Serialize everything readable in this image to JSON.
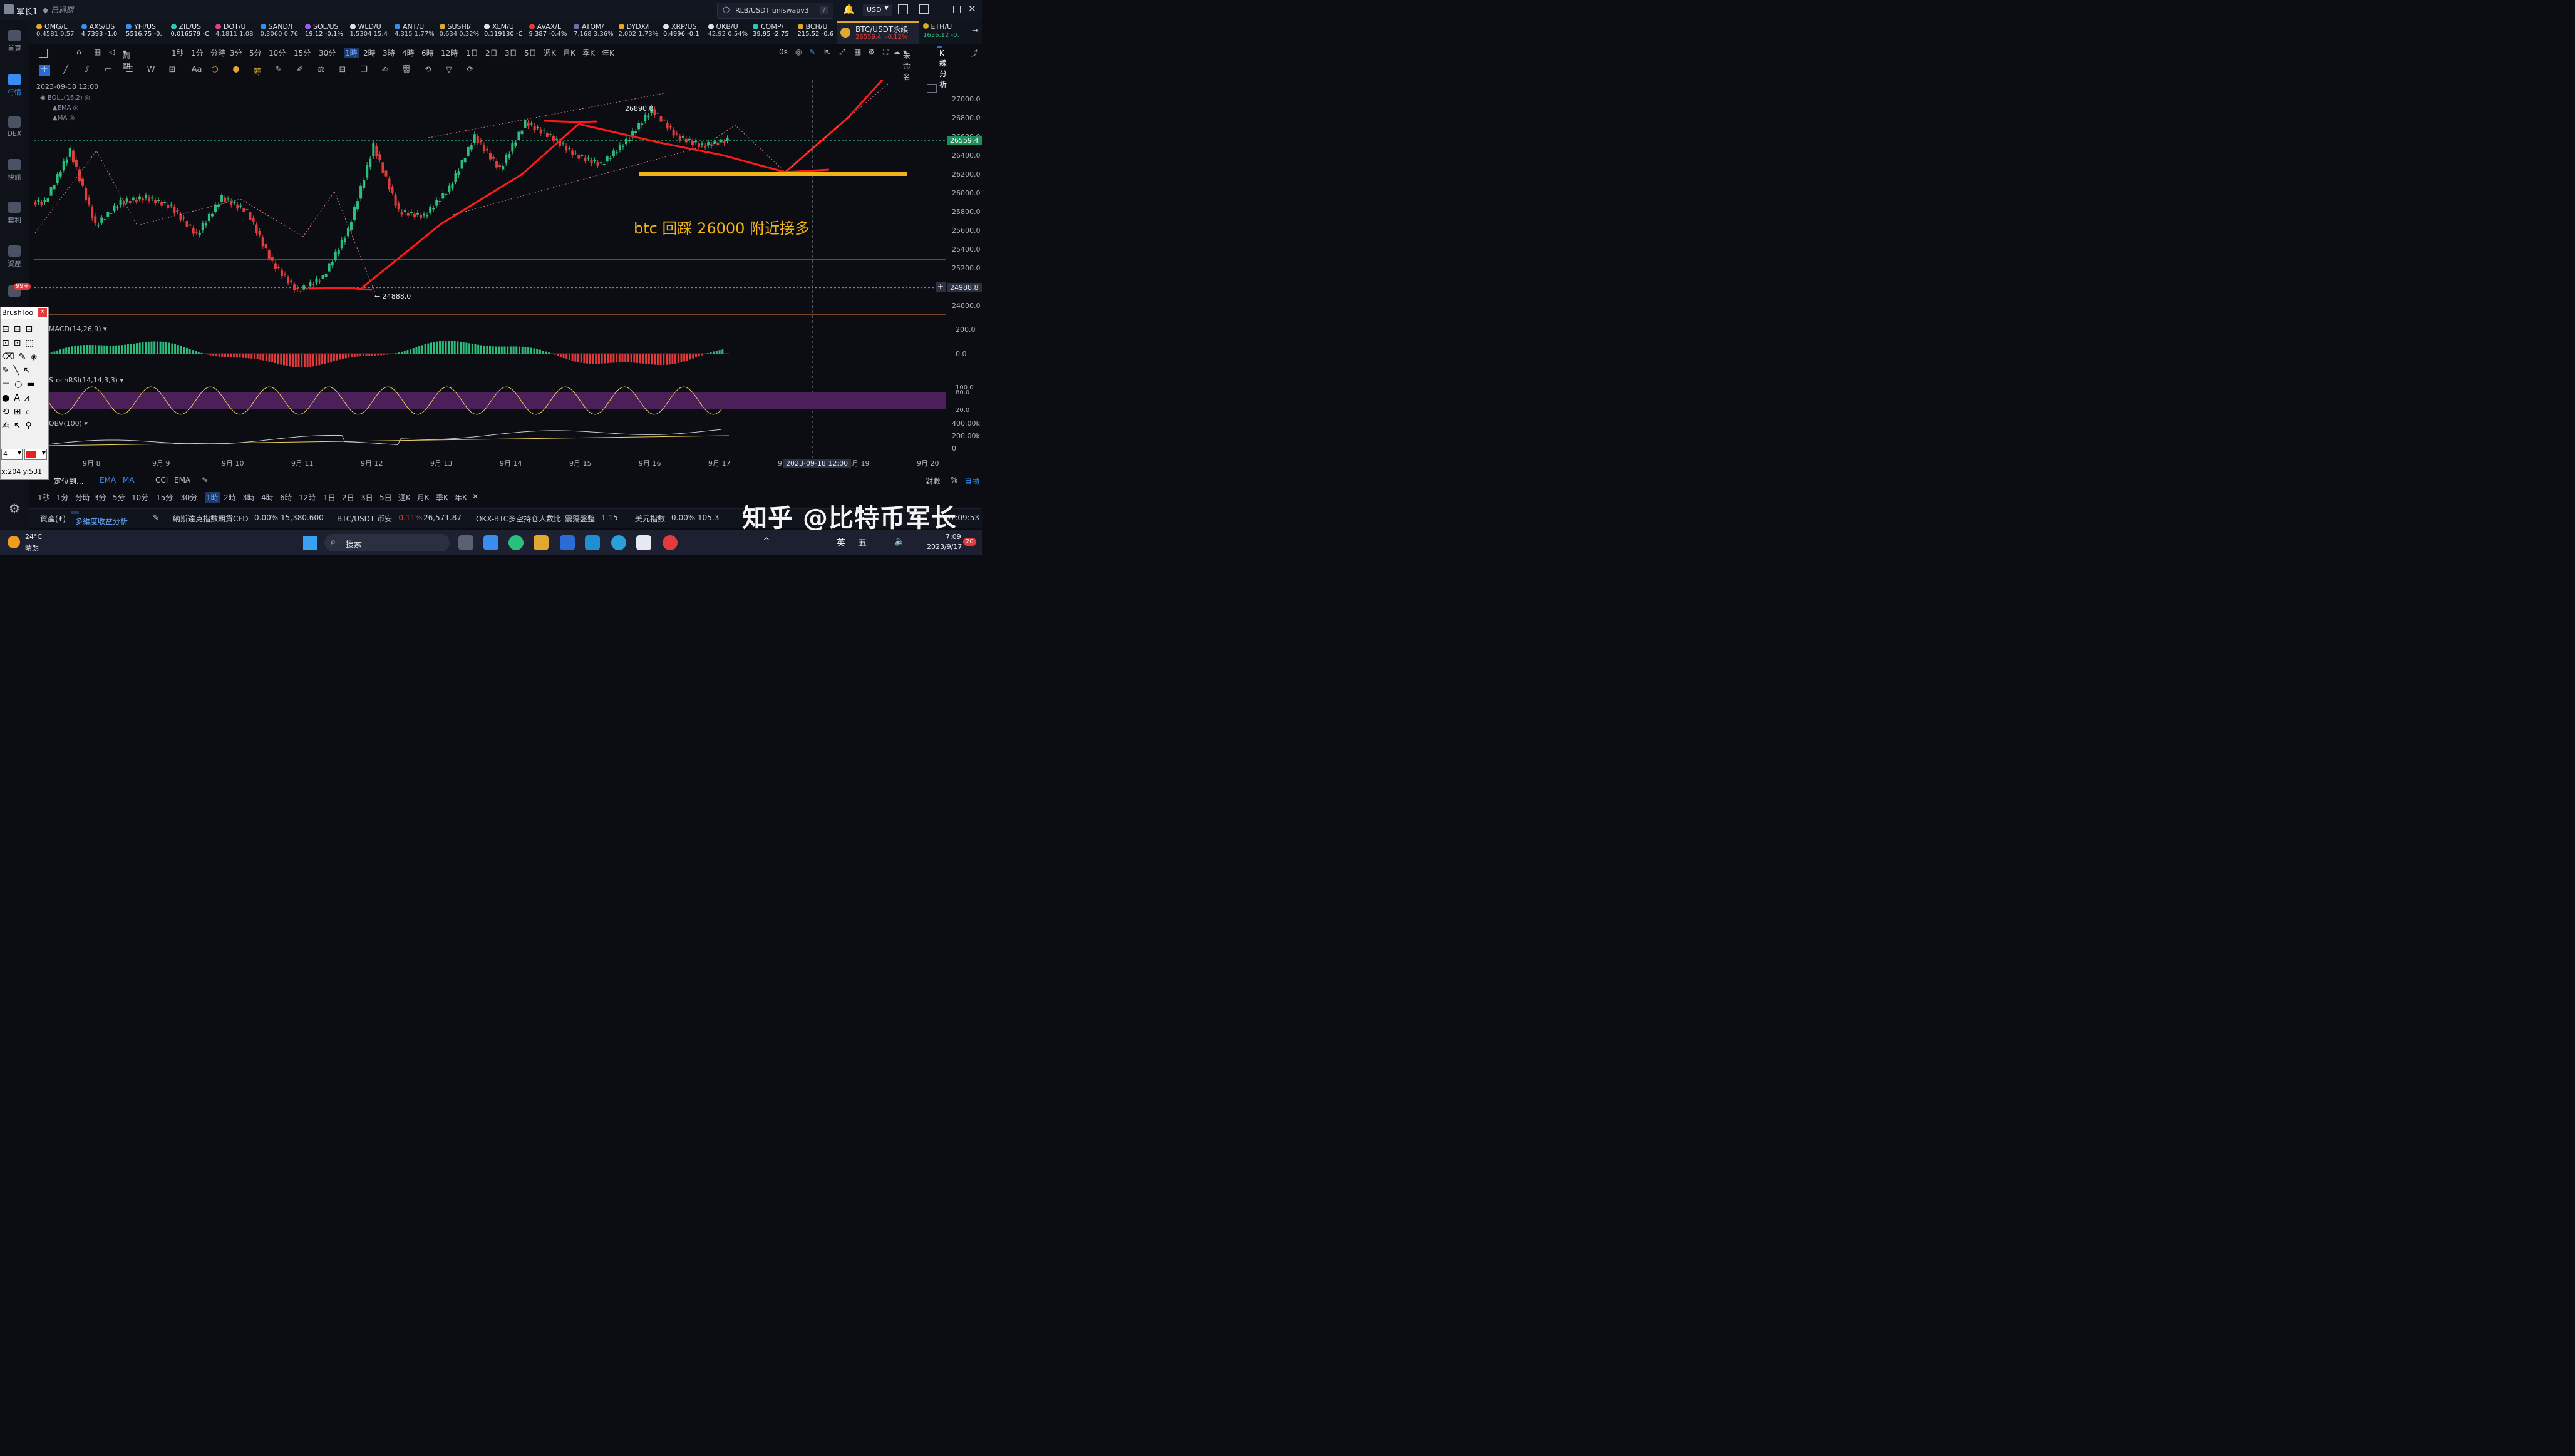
{
  "window": {
    "user": "军长1",
    "account_status": "已過期",
    "search_value": "RLB/USDT uniswapv3",
    "search_shortcut": "/",
    "currency": "USD"
  },
  "sidebar": [
    {
      "label": "首頁",
      "icon": "home-icon"
    },
    {
      "label": "行情",
      "icon": "chart-icon"
    },
    {
      "label": "DEX",
      "icon": "dex-icon"
    },
    {
      "label": "快訊",
      "icon": "news-icon"
    },
    {
      "label": "套利",
      "icon": "arbitrage-icon"
    },
    {
      "label": "資產",
      "icon": "wallet-icon"
    },
    {
      "label": "99+",
      "icon": "message-icon"
    }
  ],
  "tickers": [
    {
      "sym": "OMG/L",
      "px": "0.4581  0.57",
      "color": "#e0a82e"
    },
    {
      "sym": "AXS/US",
      "px": "4.7393  -1.0",
      "color": "#3a8df0"
    },
    {
      "sym": "YFI/US",
      "px": "5516.75  -0.",
      "color": "#3a8df0"
    },
    {
      "sym": "ZIL/US",
      "px": "0.016579  -C",
      "color": "#2ec4b6"
    },
    {
      "sym": "DOT/U",
      "px": "4.1811  1.08",
      "color": "#e23b8a"
    },
    {
      "sym": "SAND/I",
      "px": "0.3060  0.76",
      "color": "#3a8df0"
    },
    {
      "sym": "SOL/US",
      "px": "19.12  -0.1%",
      "color": "#9b5cf0"
    },
    {
      "sym": "WLD/U",
      "px": "1.5304  15.4",
      "color": "#dfe3ea"
    },
    {
      "sym": "ANT/U",
      "px": "4.315  1.77%",
      "color": "#3a8df0"
    },
    {
      "sym": "SUSHI/",
      "px": "0.634  0.32%",
      "color": "#e0a82e"
    },
    {
      "sym": "XLM/U",
      "px": "0.119130  -C",
      "color": "#dfe3ea"
    },
    {
      "sym": "AVAX/L",
      "px": "9.387  -0.4%",
      "color": "#e23b3b"
    },
    {
      "sym": "ATOM/",
      "px": "7.168  3.36%",
      "color": "#6a6fb0"
    },
    {
      "sym": "DYDX/I",
      "px": "2.002  1.73%",
      "color": "#e0a82e"
    },
    {
      "sym": "XRP/US",
      "px": "0.4996  -0.1",
      "color": "#dfe3ea"
    },
    {
      "sym": "OKB/U",
      "px": "42.92  0.54%",
      "color": "#dfe3ea"
    },
    {
      "sym": "COMP/",
      "px": "39.95  -2.75",
      "color": "#2ec4b6"
    },
    {
      "sym": "BCH/U",
      "px": "215.52  -0.6",
      "color": "#e0a82e"
    }
  ],
  "active_ticker": {
    "sym": "BTC/USDT永续",
    "price": "26559.4",
    "change": "-0.12%"
  },
  "last_ticker": {
    "sym": "ETH/U",
    "px": "1636.12  -0."
  },
  "toolbar": {
    "main_label": "主力",
    "period_label": "周期",
    "periods": [
      "1秒",
      "1分",
      "分時",
      "3分",
      "5分",
      "10分",
      "15分",
      "30分",
      "1時",
      "2時",
      "3時",
      "4時",
      "6時",
      "12時",
      "1日",
      "2日",
      "3日",
      "5日",
      "週K",
      "月K",
      "季K",
      "年K"
    ],
    "active_period": "1時",
    "timer": "0s",
    "untitled": "未命名",
    "kline_btn": "K線分析",
    "font_tool": "Aa",
    "chou_tool": "筹"
  },
  "chart": {
    "timestamp": "2023-09-18 12:00",
    "indicators": [
      "BOLL(16,2)",
      "EMA",
      "MA"
    ],
    "high_label": "26890.0",
    "low_label": "24888.0",
    "annotation": "btc 回踩 26000 附近接多",
    "current_price": "26559.4",
    "crosshair_price": "24988.8",
    "crosshair_date": "2023-09-18 12:00"
  },
  "chart_data": {
    "type": "candlestick",
    "title": "BTC/USDT永续",
    "y_ticks": [
      "27000.0",
      "26800.0",
      "26600.0",
      "26400.0",
      "26200.0",
      "26000.0",
      "25800.0",
      "25600.0",
      "25400.0",
      "25200.0",
      "25000.0",
      "24800.0"
    ],
    "x_ticks": [
      "9月 8",
      "9月 9",
      "9月 10",
      "9月 11",
      "9月 12",
      "9月 13",
      "9月 14",
      "9月 15",
      "9月 16",
      "9月 17",
      "9月",
      "9月 19",
      "9月 20"
    ],
    "ylim": [
      24800,
      27000
    ],
    "series": [
      {
        "close": [
          25900,
          26450,
          25650,
          25900,
          25950,
          25850,
          25550,
          25950,
          25800,
          25250,
          24950,
          25100,
          25600,
          26500,
          25800,
          25750,
          26050,
          26600,
          26250,
          26750,
          26600,
          26400,
          26300,
          26550,
          26890,
          26600,
          26500,
          26559.4
        ]
      }
    ]
  },
  "sub_indicators": {
    "macd": "MACD(14,26,9)",
    "macd_ticks": [
      "200.0",
      "0.0"
    ],
    "stochrsi": "StochRSI(14,14,3,3)",
    "stochrsi_ticks": [
      "100.0",
      "80.0",
      "20.0"
    ],
    "obv": "OBV(100)",
    "obv_ticks": [
      "400.00k",
      "200.00k",
      "0"
    ]
  },
  "bottom": {
    "locate": "定位到...",
    "ind1": "EMA",
    "ind2": "MA",
    "ind3": "CCI",
    "ind4": "EMA",
    "scale_log": "對數",
    "scale_pct": "%",
    "scale_auto": "自動"
  },
  "status": {
    "assets": "資產(₮)",
    "multi": "多維度收益分析",
    "nasdaq_label": "納斯達克指數期貨CFD",
    "nasdaq_chg": "0.00%",
    "nasdaq_val": "15,380.600",
    "btc_label": "BTC/USDT 币安",
    "btc_chg": "-0.11%",
    "btc_val": "26,571.87",
    "okx_label": "OKX-BTC多空持仓人数比",
    "okx_state": "震蕩盤整",
    "okx_val": "1.15",
    "usd_label": "美元指數",
    "usd_chg": "0.00%",
    "usd_val": "105.3",
    "time": "07:09:53"
  },
  "brush_tool": {
    "title": "BrushTool",
    "size": "4",
    "coords": "x:204  y:531"
  },
  "watermark": "知乎 @比特币军长",
  "taskbar": {
    "weather_temp": "24°C",
    "weather_desc": "晴朗",
    "search": "搜索",
    "lang1": "英",
    "lang2": "五",
    "clock": "7:09",
    "date": "2023/9/17",
    "notif": "20"
  }
}
